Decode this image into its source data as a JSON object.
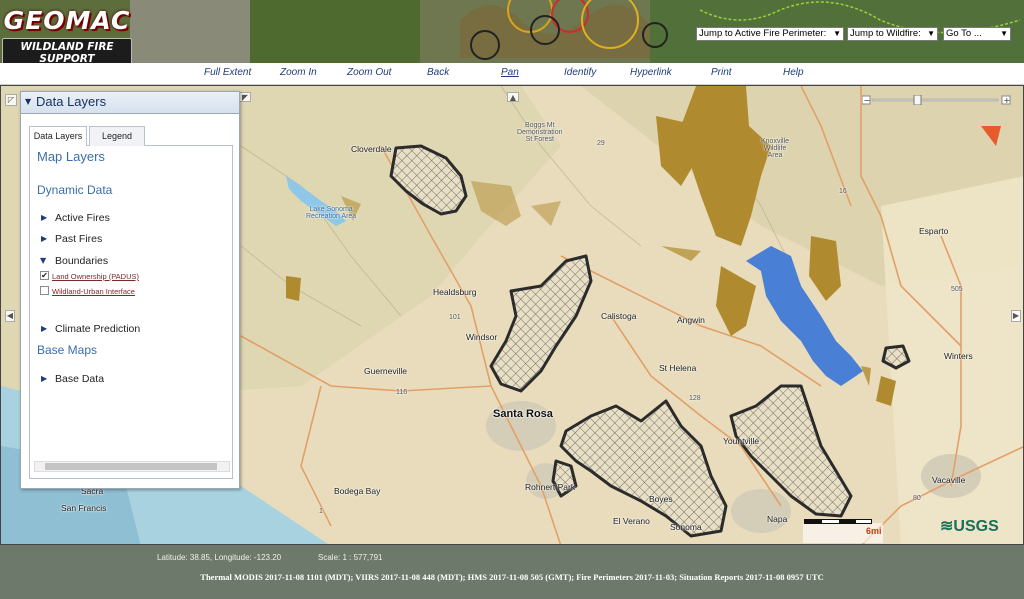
{
  "banner": {
    "logo_line1": "GEOMAC",
    "logo_line2": "WILDLAND FIRE SUPPORT",
    "selects": [
      {
        "label": "Jump to Active Fire Perimeter:"
      },
      {
        "label": "Jump to Wildfire:"
      },
      {
        "label": "Go To ..."
      }
    ]
  },
  "toolbar": {
    "items": [
      "Full Extent",
      "Zoom In",
      "Zoom Out",
      "Back",
      "Pan",
      "Identify",
      "Hyperlink",
      "Print",
      "Help"
    ],
    "active": "Pan"
  },
  "panel": {
    "title": "Data Layers",
    "tabs": [
      "Data Layers",
      "Legend"
    ],
    "map_layers": "Map Layers",
    "dynamic_data": "Dynamic Data",
    "active_fires": "Active Fires",
    "past_fires": "Past Fires",
    "boundaries": "Boundaries",
    "land_ownership": "Land Ownership (PADUS)",
    "land_ownership_checked": true,
    "wui": "Wildland-Urban Interface",
    "wui_checked": false,
    "climate_prediction": "Climate Prediction",
    "base_maps": "Base Maps",
    "base_data": "Base Data"
  },
  "map": {
    "labels": {
      "cloverdale": "Cloverdale",
      "boggs": "Boggs Mt\nDemonstration\nSt Forest",
      "knoxville": "Knoxville\nWildlife\nArea",
      "lake_sonoma": "Lake Sonoma\nRecreation Area",
      "esparto": "Esparto",
      "healdsburg": "Healdsburg",
      "calistoga": "Calistoga",
      "angwin": "Angwin",
      "windsor": "Windsor",
      "guerneville": "Guerneville",
      "st_helena": "St Helena",
      "winters": "Winters",
      "santa_rosa": "Santa Rosa",
      "yountville": "Yountville",
      "rohnert_park": "Rohnert Park",
      "bodega_bay": "Bodega Bay",
      "el_verano": "El Verano",
      "boyes": "Boyes",
      "sonoma": "Sonoma",
      "napa": "Napa",
      "vacaville": "Vacaville",
      "sacramento": "Sacra",
      "san_francisco": "San Francis",
      "r101": "101",
      "r116": "116",
      "r128": "128",
      "r29": "29",
      "r16": "16",
      "r505": "505",
      "r80": "80",
      "r1": "1"
    },
    "scale_label": "6mi",
    "usgs": "USGS"
  },
  "footer": {
    "coords": "Latitude: 38.85, Longitude: -123.20",
    "scale": "Scale: 1 : 577,791",
    "status": "Thermal MODIS 2017-11-08 1101 (MDT); VIIRS 2017-11-08 448 (MDT); HMS 2017-11-08 505 (GMT); Fire Perimeters 2017-11-03; Situation Reports 2017-11-08 0957 UTC"
  },
  "colors": {
    "fire_perimeter": "#2b2b2b",
    "public_land": "#b08a2e",
    "lake": "#4a7fd6",
    "footer_bg": "#6d7a6b",
    "link": "#1e3d7a"
  }
}
